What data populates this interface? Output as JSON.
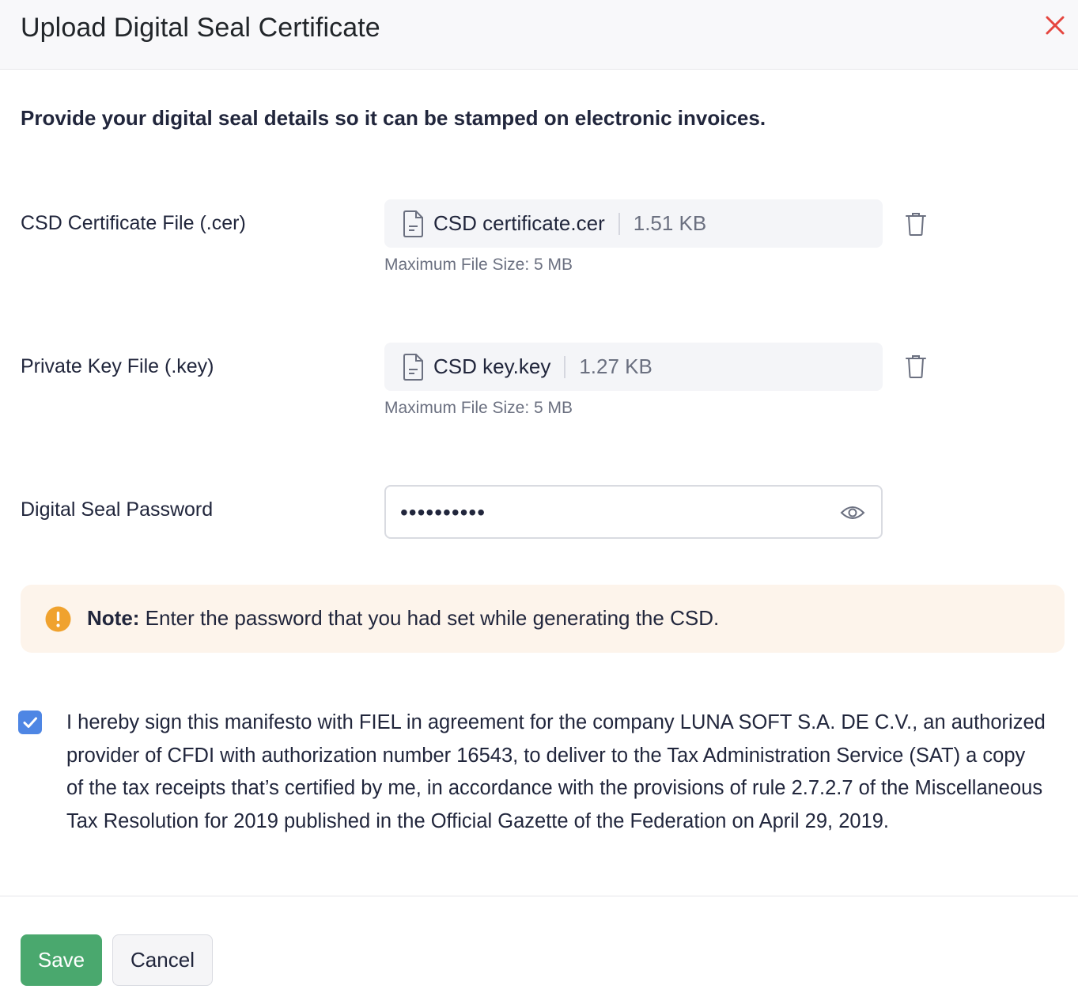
{
  "dialog": {
    "title": "Upload Digital Seal Certificate",
    "close_icon": "close-icon",
    "intro": "Provide your digital seal details so it can be stamped on electronic invoices."
  },
  "certificate_file": {
    "label": "CSD Certificate File (.cer)",
    "file_name": "CSD certificate.cer",
    "file_size": "1.51 KB",
    "hint": "Maximum File Size: 5 MB",
    "icon": "file-icon",
    "delete_icon": "trash-icon"
  },
  "key_file": {
    "label": "Private Key File (.key)",
    "file_name": "CSD key.key",
    "file_size": "1.27 KB",
    "hint": "Maximum File Size: 5 MB",
    "icon": "file-icon",
    "delete_icon": "trash-icon"
  },
  "password": {
    "label": "Digital Seal Password",
    "masked_value": "••••••••••",
    "toggle_icon": "eye-icon"
  },
  "note": {
    "icon": "warning-icon",
    "prefix": "Note:",
    "text": " Enter the password that you had set while generating the CSD."
  },
  "agreement": {
    "checked": true,
    "text": "I hereby sign this manifesto with FIEL in agreement for the company LUNA SOFT S.A. DE C.V., an authorized provider of CFDI with authorization number 16543, to deliver to the Tax Administration Service (SAT) a copy of the tax receipts that’s certified by me, in accordance with the provisions of rule 2.7.2.7 of the Miscellaneous Tax Resolution for 2019 published in the Official Gazette of the Federation on April 29, 2019."
  },
  "actions": {
    "save_label": "Save",
    "cancel_label": "Cancel"
  },
  "colors": {
    "save": "#4aa86e",
    "close": "#e5463f",
    "checkbox": "#4e86e4",
    "warning": "#f0a22e",
    "note_bg": "#fdf4eb"
  }
}
